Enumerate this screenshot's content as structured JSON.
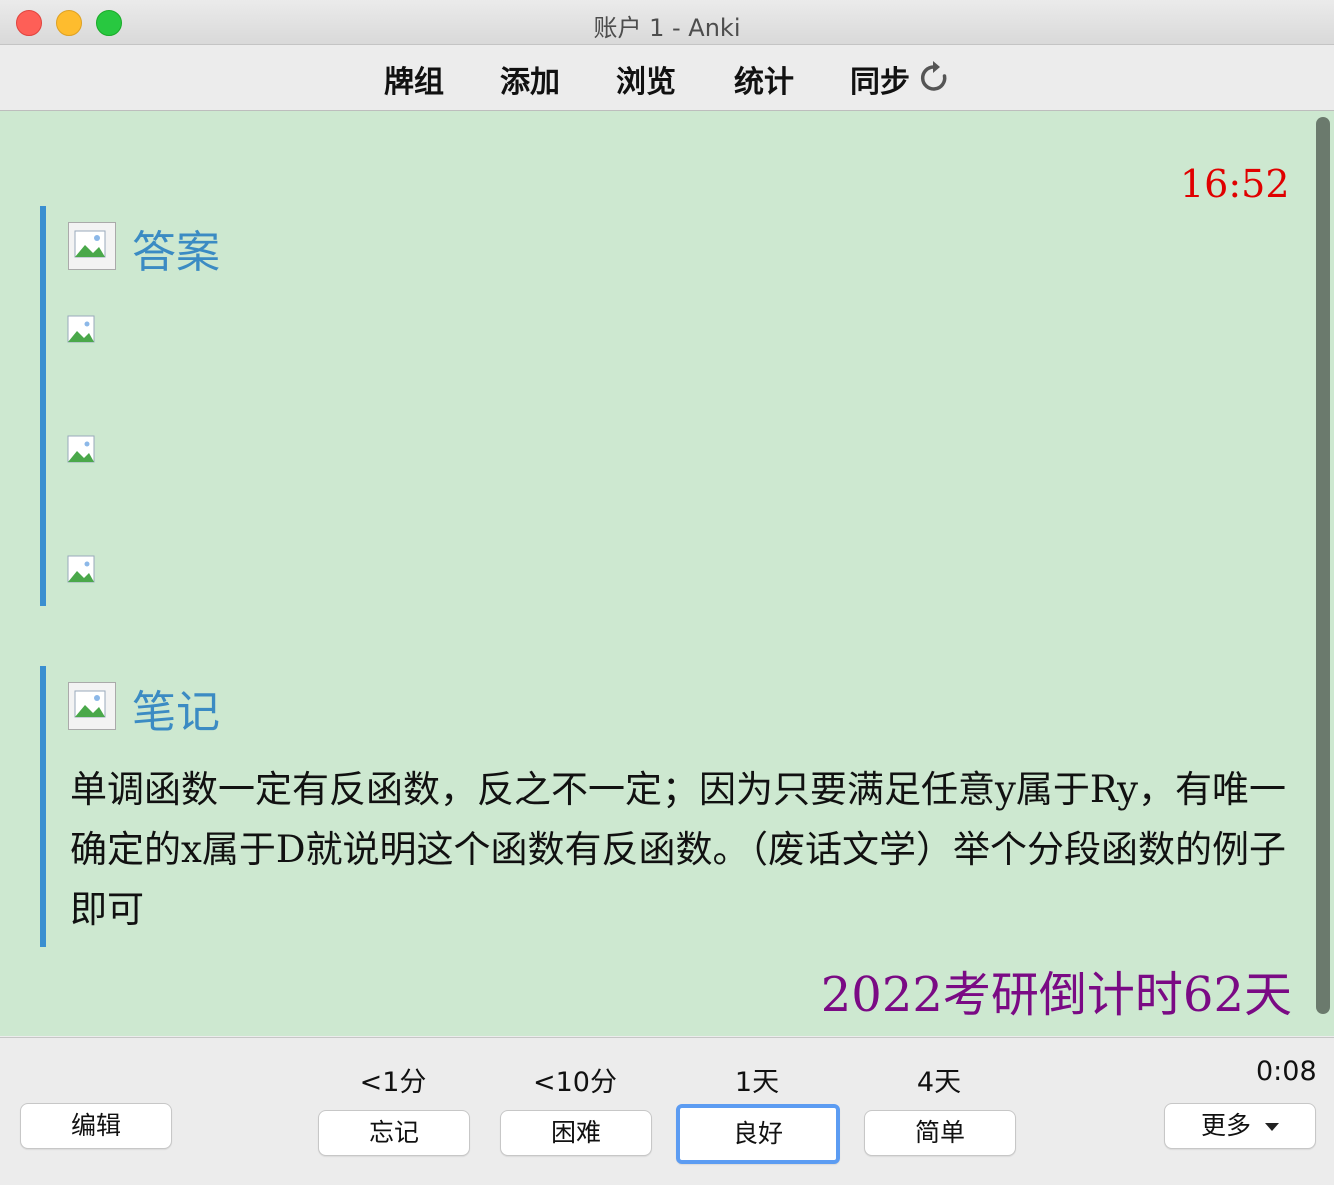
{
  "window": {
    "title": "账户 1 - Anki"
  },
  "toolbar": {
    "decks": "牌组",
    "add": "添加",
    "browse": "浏览",
    "stats": "统计",
    "sync": "同步"
  },
  "card": {
    "clock": "16:52",
    "answer_title": "答案",
    "note_title": "笔记",
    "note_text": "单调函数一定有反函数，反之不一定；因为只要满足任意y属于Ry，有唯一确定的x属于D就说明这个函数有反函数。（废话文学）举个分段函数的例子即可",
    "countdown": "2022考研倒计时62天"
  },
  "bottom": {
    "edit": "编辑",
    "answers": [
      {
        "interval": "<1分",
        "label": "忘记"
      },
      {
        "interval": "<10分",
        "label": "困难"
      },
      {
        "interval": "1天",
        "label": "良好"
      },
      {
        "interval": "4天",
        "label": "简单"
      }
    ],
    "timer": "0:08",
    "more": "更多"
  },
  "colors": {
    "card_bg": "#cde8d0",
    "accent_bar": "#3a8fd0",
    "title_blue": "#3b8bc3",
    "clock_red": "#e00000",
    "countdown_purple": "#7a0a84"
  }
}
